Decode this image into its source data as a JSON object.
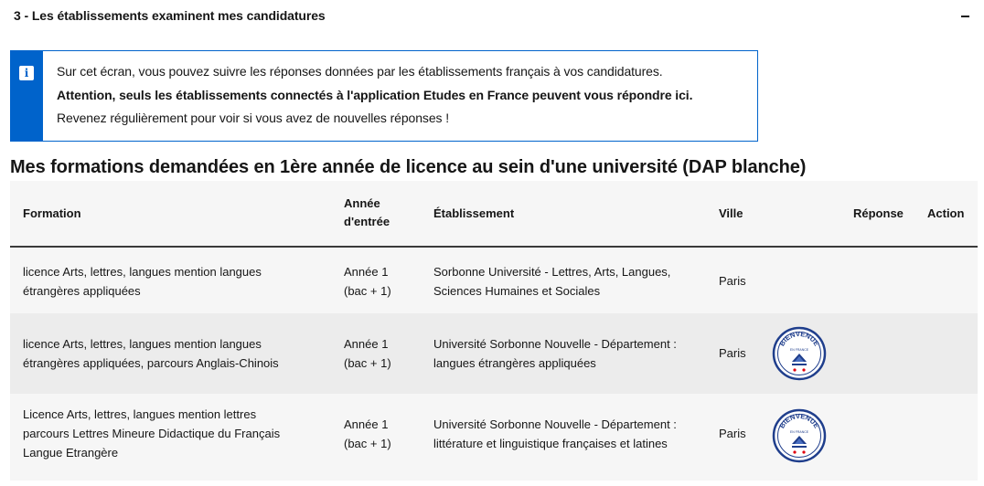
{
  "accordion": {
    "title": "3 - Les établissements examinent mes candidatures",
    "toggle_icon": "minus-icon"
  },
  "notice": {
    "icon": "info-icon",
    "line1": "Sur cet écran, vous pouvez suivre les réponses données par les établissements français à vos candidatures.",
    "line2": "Attention, seuls les établissements connectés à l'application Etudes en France peuvent vous répondre ici.",
    "line3": "Revenez régulièrement pour voir si vous avez de nouvelles réponses !",
    "accent_color": "#0063cb"
  },
  "section": {
    "title": "Mes formations demandées en 1ère année de licence au sein d'une université (DAP blanche)"
  },
  "table": {
    "headers": {
      "formation": "Formation",
      "annee_l1": "Année",
      "annee_l2": "d'entrée",
      "etablissement": "Établissement",
      "ville": "Ville",
      "reponse": "Réponse",
      "action": "Action"
    },
    "rows": [
      {
        "formation_l1": "licence Arts, lettres, langues mention langues",
        "formation_l2": "étrangères appliquées",
        "formation_l3": "",
        "annee_l1": "Année 1",
        "annee_l2": "(bac + 1)",
        "etab_l1": "Sorbonne Université - Lettres, Arts, Langues,",
        "etab_l2": "Sciences Humaines et Sociales",
        "ville": "Paris",
        "badge": ""
      },
      {
        "formation_l1": "licence Arts, lettres, langues mention langues",
        "formation_l2": "étrangères appliquées, parcours Anglais-Chinois",
        "formation_l3": "",
        "annee_l1": "Année 1",
        "annee_l2": "(bac + 1)",
        "etab_l1": "Université Sorbonne Nouvelle - Département :",
        "etab_l2": "langues étrangères appliquées",
        "ville": "Paris",
        "badge": "bienvenue-en-france-label-icon"
      },
      {
        "formation_l1": "Licence Arts, lettres, langues mention lettres",
        "formation_l2": "parcours Lettres Mineure Didactique du Français",
        "formation_l3": "Langue Etrangère",
        "annee_l1": "Année 1",
        "annee_l2": "(bac + 1)",
        "etab_l1": "Université Sorbonne Nouvelle - Département :",
        "etab_l2": "littérature et linguistique françaises et latines",
        "ville": "Paris",
        "badge": "bienvenue-en-france-label-icon"
      }
    ]
  },
  "badge_text": {
    "top": "BIENVENUE",
    "sub": "EN FRANCE"
  }
}
